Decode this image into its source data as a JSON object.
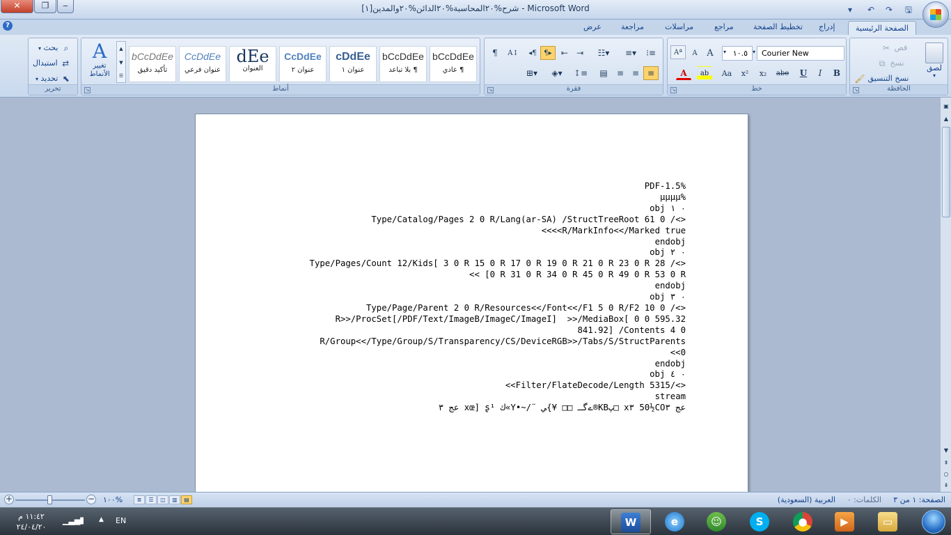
{
  "window": {
    "title": "شرح%٢٠المحاسبة%٢٠الدائن%٢٠والمدين[١] - Microsoft Word",
    "close_symbol": "✕",
    "maximize_symbol": "❐",
    "minimize_symbol": "‒"
  },
  "ribbon_tabs": [
    "الصفحة الرئيسية",
    "إدراج",
    "تخطيط الصفحة",
    "مراجع",
    "مراسلات",
    "مراجعة",
    "عرض"
  ],
  "clipboard": {
    "group": "الحافظة",
    "paste": "لصق",
    "cut": "قص",
    "copy": "نسخ",
    "format_painter": "نسخ التنسيق"
  },
  "font": {
    "group": "خط",
    "font_name": "Courier New",
    "font_size": "١٠.٥",
    "bold": "B",
    "italic": "I",
    "underline": "U",
    "strike": "abe",
    "subscript": "x₂",
    "superscript": "x²",
    "change_case": "Aa",
    "grow": "A",
    "shrink": "A",
    "font_color": "A",
    "highlight": "ab"
  },
  "paragraph": {
    "group": "فقرة"
  },
  "styles": {
    "group": "أنماط",
    "change_styles": "تغيير الأنماط",
    "items": [
      {
        "sample": "bCcDdEe",
        "name": "¶ عادي"
      },
      {
        "sample": "bCcDdEe",
        "name": "¶ بلا تباعد"
      },
      {
        "sample": "cDdEe",
        "name": "عنوان ١"
      },
      {
        "sample": "CcDdEe",
        "name": "عنوان ٢"
      },
      {
        "sample": "dEe",
        "name": "العنوان"
      },
      {
        "sample": "CcDdEe",
        "name": "عنوان فرعي"
      },
      {
        "sample": "bCcDdEe",
        "name": "تأكيد دقيق"
      }
    ]
  },
  "editing": {
    "group": "تحرير",
    "find": "بحث",
    "replace": "استبدال",
    "select": "تحديد"
  },
  "document": {
    "lines": [
      "PDF-1.5%",
      "µµµµ%",
      "obj ٠ ١",
      "Type/Catalog/Pages 2 0 R/Lang(ar-SA) /StructTreeRoot 61 0 /<>",
      "<<<<R/MarkInfo<</Marked true",
      "endobj",
      "obj ٠ ٢",
      "Type/Pages/Count 12/Kids[ 3 0 R 15 0 R 17 0 R 19 0 R 21 0 R 23 0 R 28 /<>",
      "<< [0 R 31 0 R 34 0 R 45 0 R 49 0 R 53 0 R",
      "endobj",
      "obj ٠ ٣",
      "Type/Page/Parent 2 0 R/Resources<</Font<</F1 5 0 R/F2 10 0 /<>",
      "R>>/ProcSet[/PDF/Text/ImageB/ImageC/ImageI]  >>/MediaBox[ 0 0 595.32",
      "841.92] /Contents 4 0",
      "R/Group<</Type/Group/S/Transparency/CS/DeviceRGB>>/Tabs/S/StructParents",
      "<<0",
      "endobj",
      "obj ٠ ٤",
      "<<Filter/FlateDecode/Length 5315/<>",
      "stream",
      "عج ٣ xœ] ʂ¹ ك«Y•~/¨ ےگـ □□ ¥}ﻲ®KBپ□ x٣ 50½COعج ٣"
    ]
  },
  "status_bar": {
    "page": "الصفحة: ١ من ٣",
    "words": "الكلمات: ٠",
    "language": "العربية (السعودية)",
    "zoom": "١٠٠%"
  },
  "taskbar": {
    "language": "EN",
    "time": "١١:٤٢ م",
    "date": "٢٤/٠٤/٢٠"
  }
}
